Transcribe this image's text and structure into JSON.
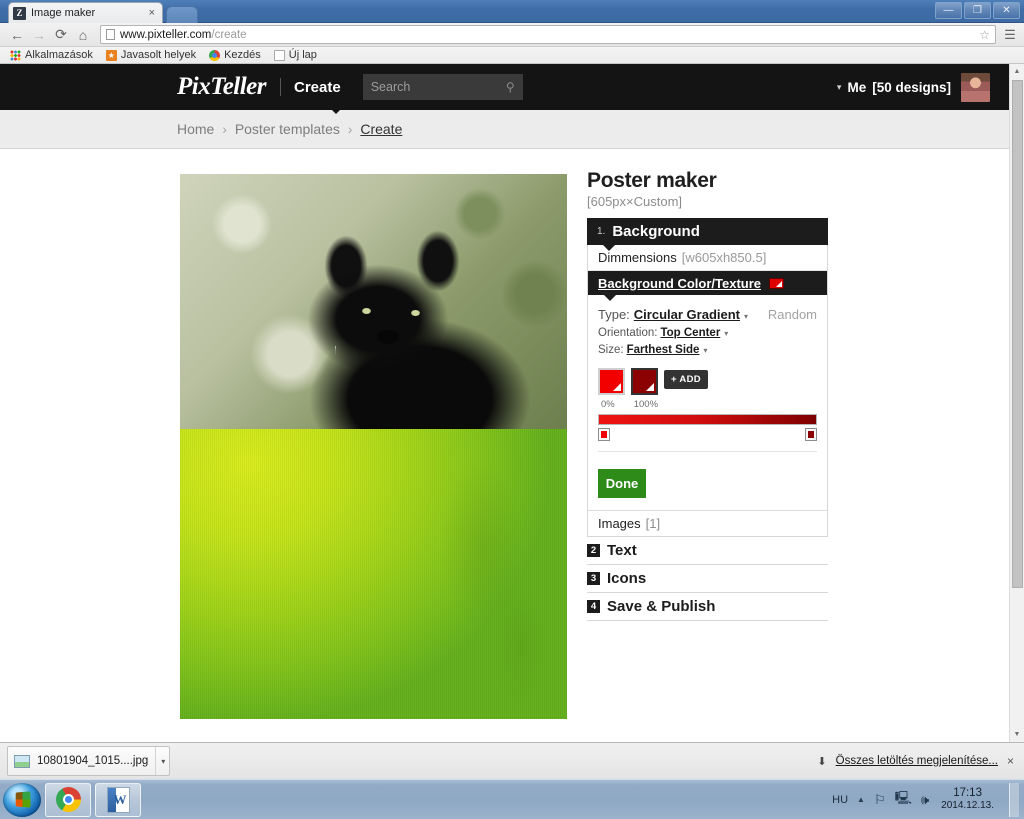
{
  "window": {
    "tab_title": "Image maker",
    "tab_favicon": "Z",
    "tab_close": "×",
    "minimize": "—",
    "restore": "❐",
    "close": "✕"
  },
  "nav": {
    "back": "←",
    "forward": "→",
    "reload": "⟳",
    "home": "⌂",
    "url_domain": "www.pixteller.com",
    "url_path": "/create",
    "bookmark_star": "☆",
    "menu": "☰"
  },
  "bookmarks": [
    {
      "label": "Alkalmazások",
      "icon": "apps-grid-icon"
    },
    {
      "label": "Javasolt helyek",
      "icon": "bookmark-star-icon"
    },
    {
      "label": "Kezdés",
      "icon": "chrome-icon"
    },
    {
      "label": "Új lap",
      "icon": "blank-page-icon"
    }
  ],
  "site_header": {
    "logo": "PixTeller",
    "create_label": "Create",
    "search_placeholder": "Search",
    "search_value": "",
    "account_label": "Me",
    "account_designs": "[50 designs]",
    "caret": "▾"
  },
  "breadcrumb": {
    "items": [
      "Home",
      "Poster templates",
      "Create"
    ],
    "separator": "›",
    "current": "Create"
  },
  "panel": {
    "title": "Poster maker",
    "subtitle": "[605px×Custom]",
    "sections": [
      {
        "num": "1.",
        "label": "Background"
      },
      {
        "num": "2",
        "label": "Text"
      },
      {
        "num": "3",
        "label": "Icons"
      },
      {
        "num": "4",
        "label": "Save & Publish"
      }
    ],
    "background": {
      "dimensions_label": "Dimmensions",
      "dimensions_value": "[w605xh850.5]",
      "bgcolor_label": "Background Color/Texture",
      "bgcolor_swatch": "#e00000",
      "type_label": "Type:",
      "type_value": "Circular Gradient",
      "random_label": "Random",
      "orientation_label": "Orientation:",
      "orientation_value": "Top Center",
      "size_label": "Size:",
      "size_value": "Farthest Side",
      "add_label": "+ ADD",
      "stop1_color": "#f20000",
      "stop2_color": "#8c0101",
      "stop1_pct": "0%",
      "stop2_pct": "100%",
      "done_label": "Done",
      "images_label": "Images",
      "images_count": "[1]"
    }
  },
  "downloads": {
    "file_name": "10801904_1015....jpg",
    "show_all_label": "Összes letöltés megjelenítése...",
    "down_arrow": "⬇",
    "close": "×",
    "caret": "▾"
  },
  "taskbar": {
    "start": "start-orb",
    "apps": [
      {
        "name": "chrome-taskbar-icon"
      },
      {
        "name": "word-taskbar-icon"
      }
    ],
    "language": "HU",
    "up_arrow": "▲",
    "time": "17:13",
    "date": "2014.12.13."
  },
  "colors": {
    "header_bg": "#141414",
    "accent_red": "#e00000",
    "done_green": "#2e8b19",
    "canvas_green_light": "#d9ec1a",
    "canvas_green_dark": "#63b01b"
  }
}
